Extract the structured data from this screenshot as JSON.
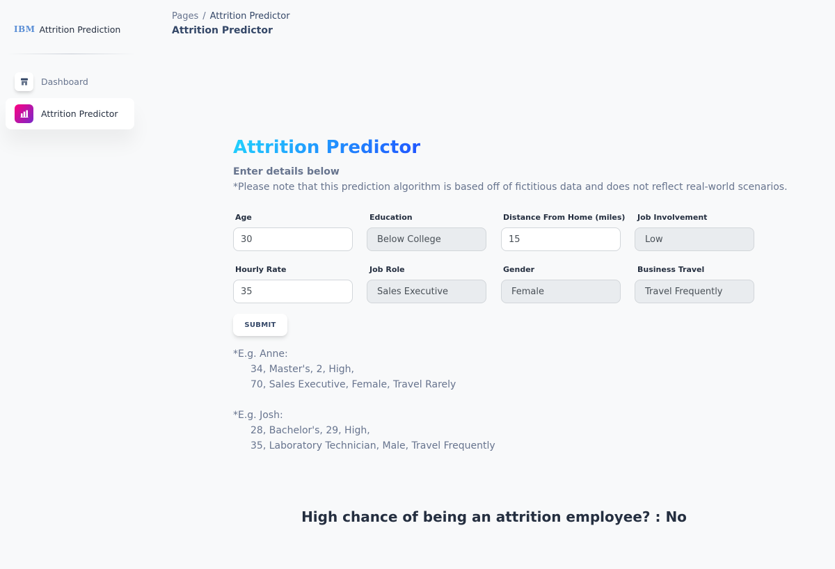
{
  "sidebar": {
    "brand_logo": "IBM",
    "brand_text": "Attrition Prediction",
    "items": [
      {
        "label": "Dashboard",
        "icon": "shop-icon",
        "active": false
      },
      {
        "label": "Attrition Predictor",
        "icon": "chart-icon",
        "active": true
      }
    ]
  },
  "breadcrumb": {
    "root": "Pages",
    "separator": "/",
    "current": "Attrition Predictor",
    "title": "Attrition Predictor"
  },
  "main": {
    "title": "Attrition Predictor",
    "subtitle": "Enter details below",
    "note": "*Please note that this prediction algorithm is based off of fictitious data and does not reflect real-world scenarios."
  },
  "form": {
    "age": {
      "label": "Age",
      "value": "30"
    },
    "education": {
      "label": "Education",
      "value": "Below College"
    },
    "distance": {
      "label": "Distance From Home (miles)",
      "value": "15"
    },
    "job_involvement": {
      "label": "Job Involvement",
      "value": "Low"
    },
    "hourly_rate": {
      "label": "Hourly Rate",
      "value": "35"
    },
    "job_role": {
      "label": "Job Role",
      "value": "Sales Executive"
    },
    "gender": {
      "label": "Gender",
      "value": "Female"
    },
    "business_travel": {
      "label": "Business Travel",
      "value": "Travel Frequently"
    },
    "submit_label": "SUBMIT"
  },
  "examples": [
    {
      "heading": "*E.g. Anne:",
      "line1": "34, Master's, 2, High,",
      "line2": "70, Sales Executive, Female, Travel Rarely"
    },
    {
      "heading": "*E.g. Josh:",
      "line1": "28, Bachelor's, 29, High,",
      "line2": "35, Laboratory Technician, Male, Travel Frequently"
    }
  ],
  "result": "High chance of being an attrition employee? : No",
  "colors": {
    "accent_gradient_start": "#2152ff",
    "accent_gradient_end": "#21d4fd",
    "active_icon_start": "#7928ca",
    "active_icon_end": "#ff0080"
  }
}
